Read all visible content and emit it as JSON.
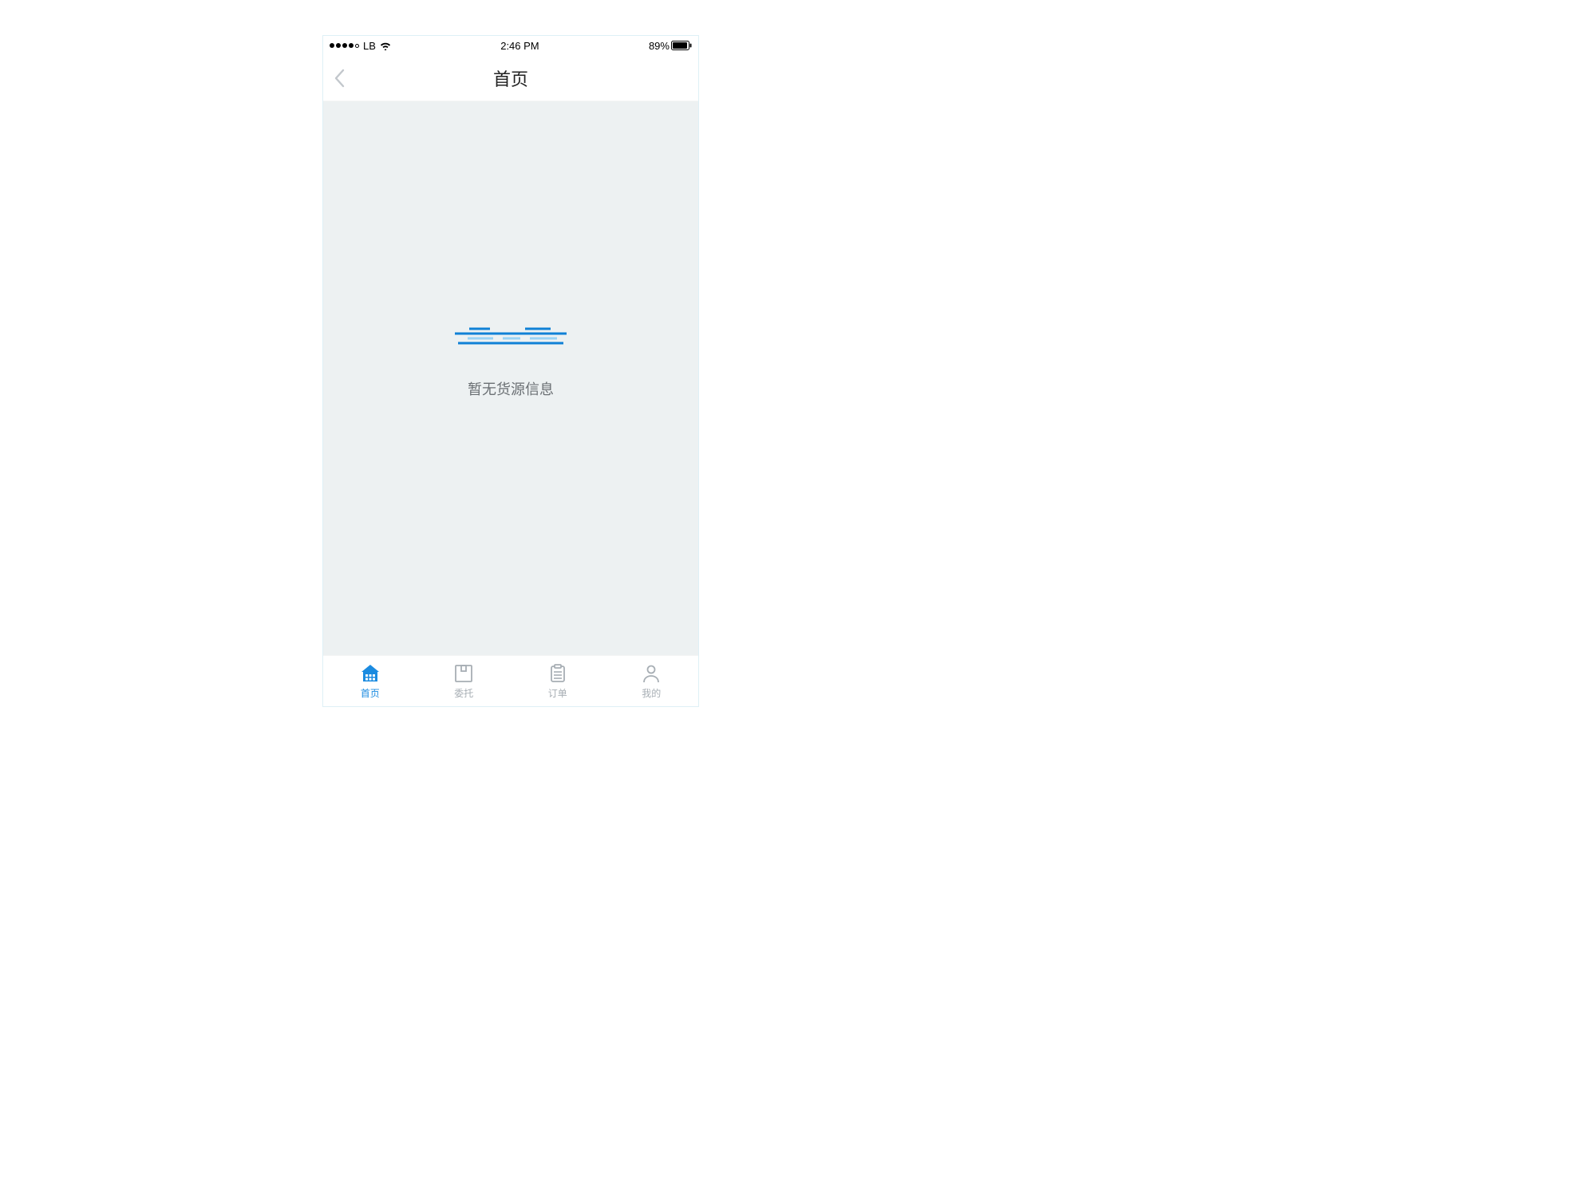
{
  "status_bar": {
    "carrier": "LB",
    "time": "2:46 PM",
    "battery_percent": "89%"
  },
  "header": {
    "title": "首页"
  },
  "content": {
    "empty_text": "暂无货源信息"
  },
  "tab_bar": {
    "items": [
      {
        "label": "首页"
      },
      {
        "label": "委托"
      },
      {
        "label": "订单"
      },
      {
        "label": "我的"
      }
    ]
  },
  "colors": {
    "accent": "#1b8be0",
    "content_bg": "#edf1f2",
    "tab_inactive": "#a7aeb4"
  }
}
